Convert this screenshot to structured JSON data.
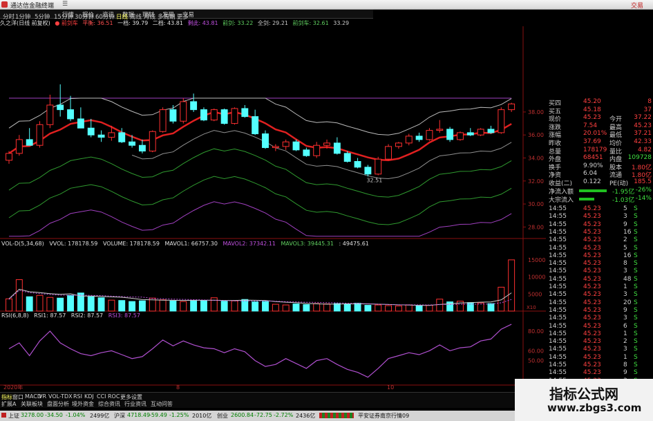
{
  "window": {
    "title": "通达信金融终端",
    "right_label": "交易"
  },
  "menu": [
    "行情",
    "报价",
    "资讯",
    "数据",
    "理财",
    "发现",
    "交易"
  ],
  "periods": [
    "分时",
    "1分钟",
    "5分钟",
    "15分钟",
    "30分钟",
    "60分钟",
    "日线",
    "周线",
    "月线",
    "多周期",
    "更多"
  ],
  "indicator_line": {
    "name": "久之洋(日线 前复权)",
    "label": "● 前剑车",
    "v1": "平衡: 36.51",
    "v2": "一档: 39.79",
    "v3": "二档: 43.81",
    "v4": "剩此: 43.81",
    "v5": "前剑: 33.22",
    "v6": "全剑: 29.21",
    "v7": "前剑车: 32.61",
    "v8": "33.29"
  },
  "price_axis": [
    "38.00",
    "36.00",
    "34.00",
    "32.00",
    "30.00",
    "28.00"
  ],
  "low_label": "32.51",
  "vol_info": [
    "VOL-D(5,34,68)",
    "VVOL: 178178.59",
    "VOLUME: 178178.59",
    "MAVOL1: 66757.30",
    "MAVOL2: 37342.11",
    "MAVOL3: 39445.31",
    ": 49475.61"
  ],
  "vol_axis": [
    "15000",
    "10000",
    "5000",
    "X10"
  ],
  "rsi_info": [
    "RSI(6,8,8)",
    "RSI1: 87.57",
    "RSI2: 87.57",
    "RSI3: 87.57"
  ],
  "rsi_axis": [
    "80.00",
    "60.00",
    "50.00"
  ],
  "date_labels": [
    "2020年",
    "8",
    "10"
  ],
  "bottom_tabs": [
    "指标",
    "窗口",
    "MACD",
    "VR",
    "VOL-TDX",
    "RSI",
    "KDJ",
    "CCI",
    "ROC",
    "更多",
    "设置"
  ],
  "bottom_tabs2": [
    "扩展A",
    "关联板块",
    "盘面分析",
    "境外资金",
    "综合资讯",
    "行业资讯",
    "互动问答"
  ],
  "quote": [
    {
      "l": "买四",
      "v": "45.20",
      "x": "",
      "y": "8"
    },
    {
      "l": "买五",
      "v": "45.18",
      "x": "",
      "y": "37"
    },
    {
      "l": "现价",
      "v": "45.23",
      "x": "今开",
      "y": "37.22"
    },
    {
      "l": "涨跌",
      "v": "7.54",
      "x": "最高",
      "y": "45.23"
    },
    {
      "l": "涨幅",
      "v": "20.01%",
      "x": "最低",
      "y": "37.21"
    },
    {
      "l": "昨收",
      "v": "37.69",
      "x": "均价",
      "y": "42.33"
    },
    {
      "l": "总量",
      "v": "178179",
      "x": "量比",
      "y": "4.82"
    },
    {
      "l": "外盘",
      "v": "68451",
      "x": "内盘",
      "y": "109728"
    },
    {
      "l": "换手",
      "v": "9.90%",
      "x": "股本",
      "y": "1.80亿"
    },
    {
      "l": "净资",
      "v": "6.04",
      "x": "流通",
      "y": "1.80亿"
    },
    {
      "l": "收益(二)",
      "v": "0.122",
      "x": "PE(动)",
      "y": "185.5"
    }
  ],
  "flows": [
    {
      "l": "净流入额",
      "a": "-1.95亿",
      "b": "-26%"
    },
    {
      "l": "大宗流入",
      "a": "-1.03亿",
      "b": "-14%"
    }
  ],
  "ticks": [
    {
      "t": "14:55",
      "p": "45.23",
      "v": "5",
      "s": "S"
    },
    {
      "t": "14:55",
      "p": "45.23",
      "v": "3",
      "s": "S"
    },
    {
      "t": "14:55",
      "p": "45.23",
      "v": "9",
      "s": "S"
    },
    {
      "t": "14:55",
      "p": "45.23",
      "v": "16",
      "s": "S"
    },
    {
      "t": "14:55",
      "p": "45.23",
      "v": "2",
      "s": "S"
    },
    {
      "t": "14:55",
      "p": "45.23",
      "v": "5",
      "s": "S"
    },
    {
      "t": "14:55",
      "p": "45.23",
      "v": "16",
      "s": "S"
    },
    {
      "t": "14:55",
      "p": "45.23",
      "v": "8",
      "s": "S"
    },
    {
      "t": "14:55",
      "p": "45.23",
      "v": "3",
      "s": "S"
    },
    {
      "t": "14:55",
      "p": "45.23",
      "v": "48",
      "s": "S"
    },
    {
      "t": "14:55",
      "p": "45.23",
      "v": "1",
      "s": "S"
    },
    {
      "t": "14:55",
      "p": "45.23",
      "v": "3",
      "s": "S"
    },
    {
      "t": "14:55",
      "p": "45.23",
      "v": "20",
      "s": "S"
    },
    {
      "t": "14:55",
      "p": "45.23",
      "v": "9",
      "s": "S"
    },
    {
      "t": "14:55",
      "p": "45.23",
      "v": "3",
      "s": "S"
    },
    {
      "t": "14:55",
      "p": "45.23",
      "v": "6",
      "s": "S"
    },
    {
      "t": "14:55",
      "p": "45.23",
      "v": "1",
      "s": "S"
    },
    {
      "t": "14:55",
      "p": "45.23",
      "v": "2",
      "s": "S"
    },
    {
      "t": "14:55",
      "p": "45.23",
      "v": "3",
      "s": "S"
    },
    {
      "t": "14:55",
      "p": "45.23",
      "v": "1",
      "s": "S"
    },
    {
      "t": "14:55",
      "p": "45.23",
      "v": "8",
      "s": "S"
    },
    {
      "t": "14:55",
      "p": "45.23",
      "v": "9",
      "s": "S"
    },
    {
      "t": "14:55",
      "p": "45.23",
      "v": "3",
      "s": "S"
    },
    {
      "t": "14:55",
      "p": "45.23",
      "v": "2",
      "s": "S"
    }
  ],
  "status": {
    "sh_label": "上证",
    "sh": "3278.00",
    "sh_chg": "-34.50",
    "sh_pct": "-1.04%",
    "sh_amt": "2499亿",
    "sz_label": "沪深",
    "sz": "4718.49",
    "sz_chg": "-59.49",
    "sz_pct": "-1.25%",
    "sz_amt": "2010亿",
    "cy_label": "创业",
    "cy": "2600.84",
    "cy_chg": "-72.75",
    "cy_pct": "-2.72%",
    "cy_amt": "2436亿",
    "broker": "平安证券南京行情09"
  },
  "watermark": {
    "title": "指标公式网",
    "url": "www.zbgs3.com"
  },
  "colors": {
    "up": "#ff3030",
    "down": "#54ffff",
    "ma_red": "#e02020",
    "purple": "#a040c0",
    "green": "#2f9a2f"
  },
  "candles": [
    [
      33.8,
      34.6,
      33.5,
      34.4
    ],
    [
      34.4,
      36.0,
      34.2,
      35.6
    ],
    [
      35.6,
      36.6,
      35.2,
      35.1
    ],
    [
      35.1,
      37.2,
      34.9,
      36.9
    ],
    [
      36.9,
      39.5,
      36.6,
      38.6
    ],
    [
      38.6,
      40.4,
      37.6,
      38.2
    ],
    [
      38.2,
      39.4,
      37.2,
      37.4
    ],
    [
      37.4,
      38.4,
      36.6,
      36.6
    ],
    [
      36.6,
      37.4,
      35.8,
      36.0
    ],
    [
      36.0,
      36.4,
      35.4,
      35.8
    ],
    [
      35.8,
      36.8,
      35.5,
      36.2
    ],
    [
      36.2,
      36.6,
      35.3,
      35.4
    ],
    [
      35.4,
      36.0,
      34.9,
      35.1
    ],
    [
      35.1,
      35.6,
      34.4,
      34.6
    ],
    [
      34.6,
      36.4,
      34.5,
      36.3
    ],
    [
      36.3,
      38.4,
      36.2,
      38.2
    ],
    [
      38.2,
      38.6,
      37.0,
      37.2
    ],
    [
      37.2,
      39.2,
      37.0,
      38.9
    ],
    [
      38.9,
      39.6,
      38.0,
      38.2
    ],
    [
      38.2,
      38.4,
      37.2,
      37.3
    ],
    [
      37.3,
      38.3,
      37.2,
      38.2
    ],
    [
      38.2,
      38.3,
      36.9,
      37.0
    ],
    [
      37.0,
      38.4,
      36.9,
      38.3
    ],
    [
      38.3,
      38.6,
      37.5,
      37.6
    ],
    [
      37.6,
      38.2,
      36.0,
      36.1
    ],
    [
      36.1,
      36.4,
      34.8,
      34.9
    ],
    [
      34.9,
      35.2,
      34.6,
      35.0
    ],
    [
      35.0,
      35.6,
      34.7,
      35.4
    ],
    [
      35.4,
      35.6,
      34.6,
      34.7
    ],
    [
      34.7,
      34.9,
      34.1,
      34.2
    ],
    [
      34.2,
      35.4,
      34.0,
      35.1
    ],
    [
      35.1,
      35.6,
      34.8,
      35.3
    ],
    [
      35.3,
      35.8,
      34.3,
      34.4
    ],
    [
      34.4,
      34.6,
      33.6,
      33.7
    ],
    [
      33.7,
      34.0,
      33.1,
      33.2
    ],
    [
      33.2,
      33.4,
      32.4,
      32.6
    ],
    [
      32.6,
      34.1,
      32.5,
      33.9
    ],
    [
      33.9,
      35.2,
      33.8,
      35.0
    ],
    [
      35.0,
      35.4,
      34.8,
      35.3
    ],
    [
      35.3,
      36.1,
      35.1,
      35.9
    ],
    [
      35.9,
      36.2,
      35.4,
      35.6
    ],
    [
      35.6,
      36.6,
      35.5,
      36.4
    ],
    [
      36.4,
      37.3,
      36.2,
      36.5
    ],
    [
      36.5,
      36.7,
      35.4,
      35.6
    ],
    [
      35.6,
      36.3,
      35.5,
      36.2
    ],
    [
      36.2,
      36.6,
      35.9,
      36.0
    ],
    [
      36.0,
      36.6,
      35.9,
      36.5
    ],
    [
      36.5,
      36.8,
      36.1,
      36.2
    ],
    [
      36.2,
      38.4,
      36.1,
      38.2
    ],
    [
      38.2,
      38.8,
      38.0,
      38.7
    ]
  ],
  "volumes": [
    3600,
    9200,
    4200,
    4600,
    4000,
    3800,
    4600,
    5300,
    4200,
    3900,
    3200,
    3100,
    2800,
    3000,
    3800,
    3300,
    3000,
    2800,
    3000,
    3100,
    3900,
    2900,
    3000,
    3400,
    2700,
    2800,
    2000,
    1800,
    2100,
    1900,
    2200,
    2100,
    2200,
    2100,
    2300,
    1700,
    1800,
    1600,
    1500,
    1800,
    1600,
    1700,
    3500,
    2700,
    2900,
    2500,
    2400,
    2200,
    7000,
    15000
  ],
  "rsi": [
    62,
    68,
    55,
    70,
    80,
    68,
    62,
    57,
    55,
    58,
    60,
    56,
    52,
    54,
    62,
    71,
    65,
    70,
    66,
    63,
    62,
    58,
    62,
    59,
    50,
    44,
    46,
    52,
    47,
    42,
    50,
    52,
    46,
    41,
    38,
    33,
    42,
    52,
    55,
    58,
    56,
    60,
    66,
    60,
    63,
    64,
    70,
    72,
    82,
    87
  ]
}
